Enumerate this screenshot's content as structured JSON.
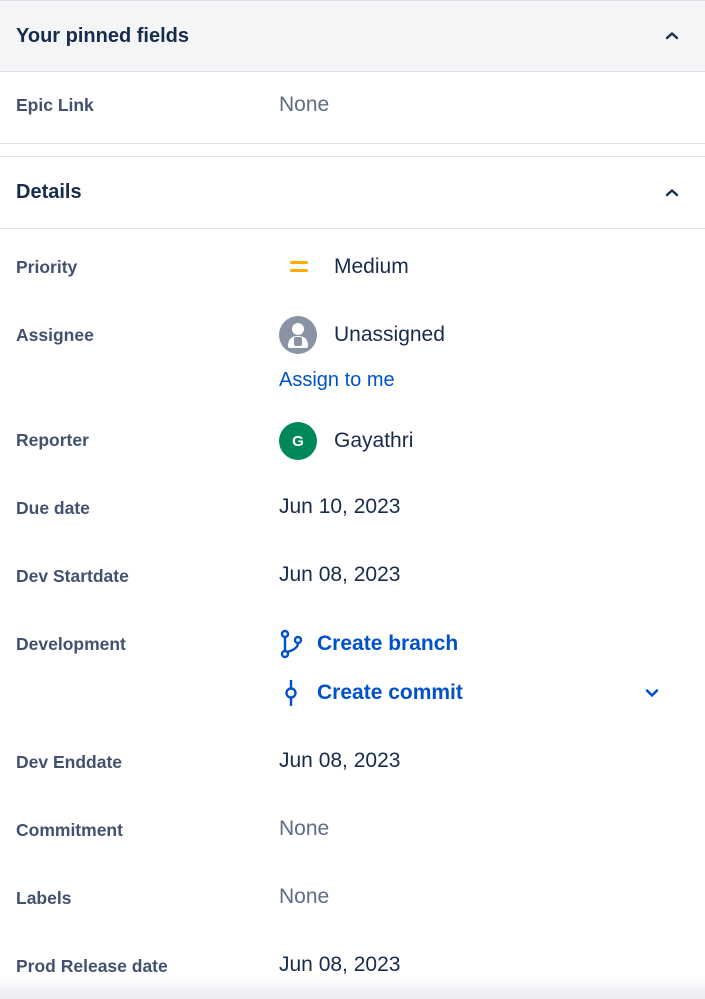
{
  "pinned": {
    "title": "Your pinned fields",
    "fields": [
      {
        "label": "Epic Link",
        "value": "None"
      }
    ]
  },
  "details": {
    "title": "Details",
    "priority": {
      "label": "Priority",
      "value": "Medium",
      "icon": "priority-medium-icon",
      "color": "#ffab00"
    },
    "assignee": {
      "label": "Assignee",
      "value": "Unassigned",
      "action": "Assign to me"
    },
    "reporter": {
      "label": "Reporter",
      "value": "Gayathri",
      "avatar_initial": "G",
      "avatar_color": "#00875a"
    },
    "due_date": {
      "label": "Due date",
      "value": "Jun 10, 2023"
    },
    "dev_startdate": {
      "label": "Dev Startdate",
      "value": "Jun 08, 2023"
    },
    "development": {
      "label": "Development",
      "create_branch": "Create branch",
      "create_commit": "Create commit"
    },
    "dev_enddate": {
      "label": "Dev Enddate",
      "value": "Jun 08, 2023"
    },
    "commitment": {
      "label": "Commitment",
      "value": "None"
    },
    "labels": {
      "label": "Labels",
      "value": "None"
    },
    "prod_release_date": {
      "label": "Prod Release date",
      "value": "Jun 08, 2023"
    }
  },
  "colors": {
    "link": "#0052cc",
    "text": "#172b4d",
    "label": "#42526e",
    "muted": "#5e6c84"
  }
}
